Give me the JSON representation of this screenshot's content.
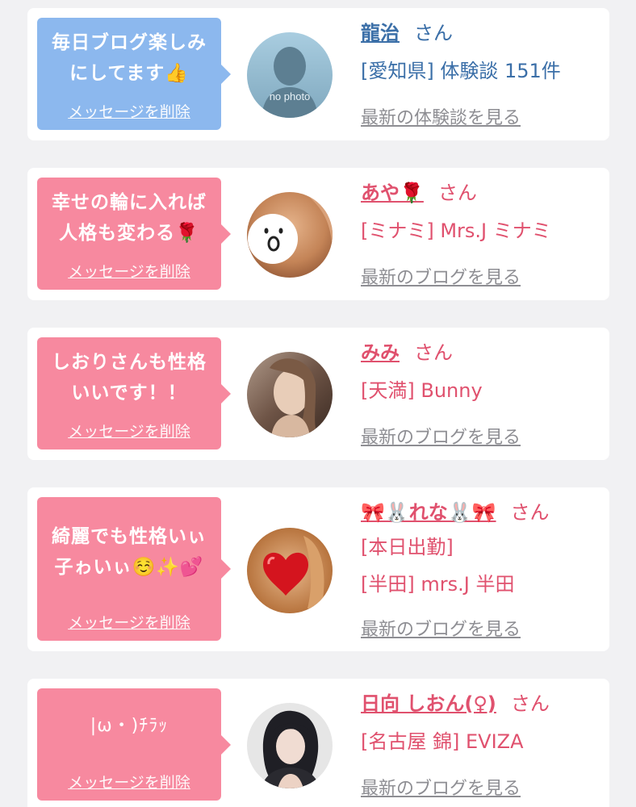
{
  "messages": [
    {
      "bubble_text": "毎日ブログ楽しみ\nにしてます👍",
      "delete_label": "メッセージを削除",
      "name": "龍治",
      "honorific": "さん",
      "details": [
        "[愛知県] 体験談 151件"
      ],
      "latest_link": "最新の体験談を見る",
      "avatar": "no-photo-placeholder",
      "avatar_text": "no photo",
      "theme": "blue"
    },
    {
      "bubble_text": "幸せの輪に入れば\n人格も変わる🌹",
      "delete_label": "メッセージを削除",
      "name": "あや🌹",
      "honorific": "さん",
      "details": [
        "[ミナミ] Mrs.J ミナミ"
      ],
      "latest_link": "最新のブログを見る",
      "avatar": "blurred-face-photo",
      "theme": "pink"
    },
    {
      "bubble_text": "しおりさんも性格\nいいです！！",
      "delete_label": "メッセージを削除",
      "name": "みみ",
      "honorific": "さん",
      "details": [
        "[天満] Bunny"
      ],
      "latest_link": "最新のブログを見る",
      "avatar": "profile-photo",
      "theme": "pink"
    },
    {
      "bubble_text": "綺麗でも性格いぃ\n子ゎいぃ☺️✨💕",
      "delete_label": "メッセージを削除",
      "name": "🎀🐰れな🐰🎀",
      "honorific": "さん",
      "details": [
        "[本日出勤]",
        "[半田] mrs.J 半田"
      ],
      "latest_link": "最新のブログを見る",
      "avatar": "heart-covered-photo",
      "theme": "pink"
    },
    {
      "bubble_text": "|ω・)ﾁﾗｯ",
      "delete_label": "メッセージを削除",
      "name": "日向 しおん(♀)",
      "honorific": "さん",
      "details": [
        "[名古屋 錦] EVIZA"
      ],
      "latest_link": "最新のブログを見る",
      "avatar": "profile-photo",
      "theme": "pink"
    }
  ],
  "colors": {
    "blue_bubble": "#8cb8ee",
    "pink_bubble": "#f7899f",
    "blue_text": "#3b6fa8",
    "pink_text": "#e0516e",
    "page_background": "#f1f1f3",
    "card_background": "#ffffff",
    "link_gray": "#8e8e93"
  }
}
